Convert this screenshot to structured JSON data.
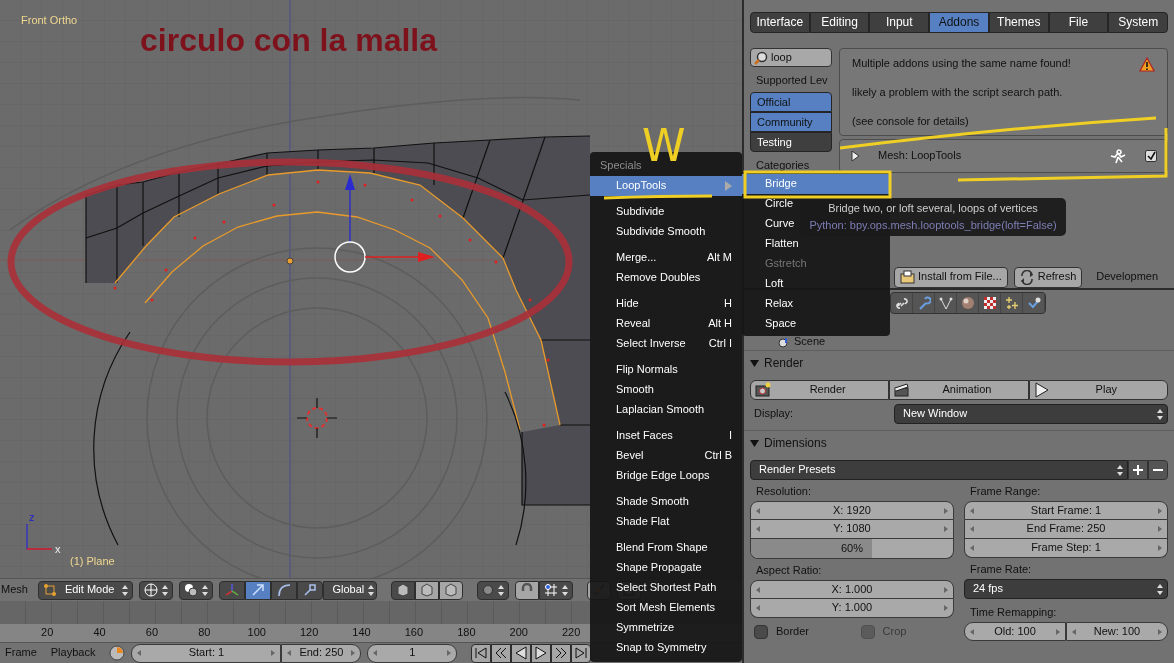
{
  "viewport": {
    "view_name": "Front Ortho",
    "overlay_text": "circulo con la malla",
    "object_name": "(1) Plane",
    "axis_z": "z",
    "axis_x": "x"
  },
  "view3d_header": {
    "menu": "Mesh",
    "mode": "Edit Mode",
    "orientation": "Global",
    "manipulators": [
      {
        "kind": "toggle",
        "selected": false
      },
      {
        "kind": "translate",
        "selected": true
      },
      {
        "kind": "rotate",
        "selected": false
      },
      {
        "kind": "scale",
        "selected": false
      }
    ]
  },
  "timeline": {
    "ticks": [
      "20",
      "40",
      "60",
      "80",
      "100",
      "120",
      "140",
      "160",
      "180",
      "200",
      "220"
    ]
  },
  "timeline_header": {
    "menus": [
      "Frame",
      "Playback"
    ],
    "start": "Start: 1",
    "end": "End: 250",
    "current_frame": "1"
  },
  "preferences": {
    "tabs": [
      {
        "label": "Interface",
        "selected": false
      },
      {
        "label": "Editing",
        "selected": false
      },
      {
        "label": "Input",
        "selected": false
      },
      {
        "label": "Addons",
        "selected": true
      },
      {
        "label": "Themes",
        "selected": false
      },
      {
        "label": "File",
        "selected": false
      },
      {
        "label": "System",
        "selected": false
      }
    ],
    "search": "loop",
    "supported_label": "Supported Lev",
    "support_levels": [
      {
        "label": "Official",
        "selected": true
      },
      {
        "label": "Community",
        "selected": true
      },
      {
        "label": "Testing",
        "selected": false
      }
    ],
    "categories_label": "Categories",
    "warning_lines": [
      "Multiple addons using the same name found!",
      "likely a problem with the script search path.",
      "(see console for details)"
    ],
    "addon": {
      "name": "Mesh: LoopTools",
      "enabled": true,
      "expanded": false
    },
    "buttons": [
      "Install from File...",
      "Refresh"
    ],
    "development": "Developmen"
  },
  "properties": {
    "breadcrumb": "Scene",
    "render": {
      "title": "Render",
      "expanded": true,
      "buttons": [
        "Render",
        "Animation",
        "Play"
      ],
      "display_label": "Display:",
      "display": "New Window"
    },
    "dimensions": {
      "title": "Dimensions",
      "expanded": true,
      "presets": "Render Presets",
      "resolution_label": "Resolution:",
      "res_x": "X: 1920",
      "res_y": "Y: 1080",
      "percent": {
        "text": "60%",
        "level": 0.6
      },
      "frame_range_label": "Frame Range:",
      "frame_fields": [
        "Start Frame: 1",
        "End Frame: 250",
        "Frame Step: 1"
      ],
      "aspect_label": "Aspect Ratio:",
      "aspect_x": "X: 1.000",
      "aspect_y": "Y: 1.000",
      "options": [
        {
          "label": "Border",
          "checked": false,
          "disabled": false
        },
        {
          "label": "Crop",
          "checked": false,
          "disabled": true
        }
      ],
      "frame_rate_label": "Frame Rate:",
      "frame_rate": "24 fps",
      "remap_label": "Time Remapping:",
      "remap_old": "Old: 100",
      "remap_new": "New: 100"
    }
  },
  "specials_menu": {
    "title": "Specials",
    "groups": [
      {
        "items": [
          {
            "label": "LoopTools",
            "kind": "submenu",
            "selected": true
          }
        ]
      },
      {
        "items": [
          {
            "label": "Subdivide",
            "kind": "command",
            "selected": false
          },
          {
            "label": "Subdivide Smooth",
            "kind": "command",
            "selected": false
          }
        ]
      },
      {
        "items": [
          {
            "label": "Merge...",
            "shortcut": "Alt M",
            "kind": "command",
            "selected": false
          },
          {
            "label": "Remove Doubles",
            "kind": "command",
            "selected": false
          }
        ]
      },
      {
        "items": [
          {
            "label": "Hide",
            "shortcut": "H",
            "kind": "command",
            "selected": false
          },
          {
            "label": "Reveal",
            "shortcut": "Alt H",
            "kind": "command",
            "selected": false
          },
          {
            "label": "Select Inverse",
            "shortcut": "Ctrl I",
            "kind": "command",
            "selected": false
          }
        ]
      },
      {
        "items": [
          {
            "label": "Flip Normals",
            "kind": "command",
            "selected": false
          },
          {
            "label": "Smooth",
            "kind": "command",
            "selected": false
          },
          {
            "label": "Laplacian Smooth",
            "kind": "command",
            "selected": false
          }
        ]
      },
      {
        "items": [
          {
            "label": "Inset Faces",
            "shortcut": "I",
            "kind": "command",
            "selected": false
          },
          {
            "label": "Bevel",
            "shortcut": "Ctrl B",
            "kind": "command",
            "selected": false
          },
          {
            "label": "Bridge Edge Loops",
            "kind": "command",
            "selected": false
          }
        ]
      },
      {
        "items": [
          {
            "label": "Shade Smooth",
            "kind": "command",
            "selected": false
          },
          {
            "label": "Shade Flat",
            "kind": "command",
            "selected": false
          }
        ]
      },
      {
        "items": [
          {
            "label": "Blend From Shape",
            "kind": "command",
            "selected": false
          },
          {
            "label": "Shape Propagate",
            "kind": "command",
            "selected": false
          },
          {
            "label": "Select Shortest Path",
            "kind": "command",
            "selected": false
          },
          {
            "label": "Sort Mesh Elements",
            "kind": "command",
            "selected": false
          },
          {
            "label": "Symmetrize",
            "kind": "command",
            "selected": false
          },
          {
            "label": "Snap to Symmetry",
            "kind": "command",
            "selected": false
          }
        ]
      }
    ]
  },
  "loop_tools_submenu": {
    "items": [
      {
        "label": "Bridge",
        "selected": true,
        "disabled": false
      },
      {
        "label": "Circle",
        "selected": false,
        "disabled": false
      },
      {
        "label": "Curve",
        "selected": false,
        "disabled": false
      },
      {
        "label": "Flatten",
        "selected": false,
        "disabled": false
      },
      {
        "label": "Gstretch",
        "selected": false,
        "disabled": true
      },
      {
        "label": "Loft",
        "selected": false,
        "disabled": false
      },
      {
        "label": "Relax",
        "selected": false,
        "disabled": false
      },
      {
        "label": "Space",
        "selected": false,
        "disabled": false
      }
    ]
  },
  "tooltip": {
    "text": "Bridge two, or loft several, loops of vertices",
    "python": "Python: bpy.ops.mesh.looptools_bridge(loft=False)"
  },
  "annotation_letter": "W"
}
